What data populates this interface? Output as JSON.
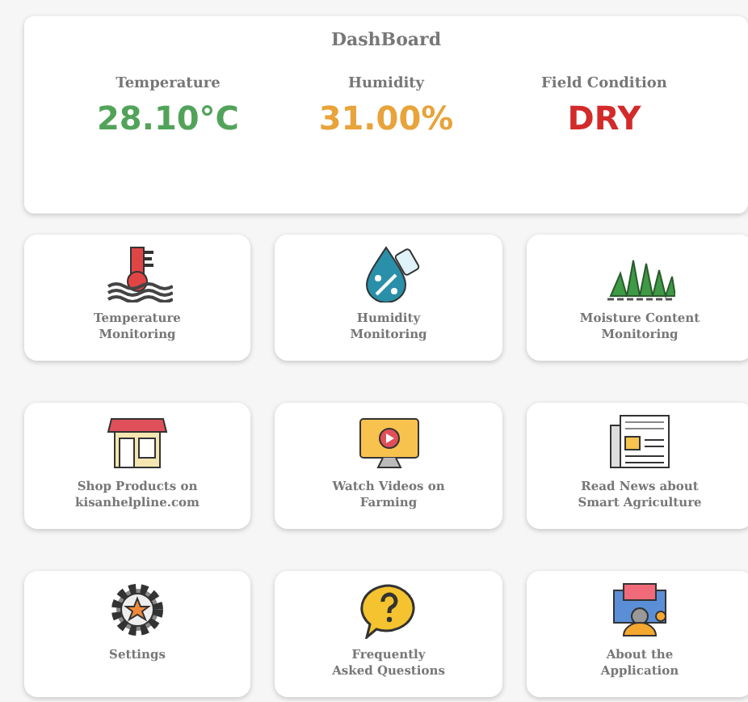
{
  "dashboard": {
    "title": "DashBoard",
    "stats": [
      {
        "label": "Temperature",
        "value": "28.10°C",
        "color": "#52a35a"
      },
      {
        "label": "Humidity",
        "value": "31.00%",
        "color": "#e8a33a"
      },
      {
        "label": "Field Condition",
        "value": "DRY",
        "color": "#d32a2a"
      }
    ]
  },
  "tiles": [
    {
      "kind": "thermometer",
      "label_lines": [
        "Temperature",
        "Monitoring"
      ]
    },
    {
      "kind": "droplet",
      "label_lines": [
        "Humidity",
        "Monitoring"
      ]
    },
    {
      "kind": "grass",
      "label_lines": [
        "Moisture Content",
        "Monitoring"
      ]
    },
    {
      "kind": "shop",
      "label_lines": [
        "Shop Products on",
        "kisanhelpline.com"
      ]
    },
    {
      "kind": "video",
      "label_lines": [
        "Watch Videos on",
        "Farming"
      ]
    },
    {
      "kind": "news",
      "label_lines": [
        "Read News about",
        "Smart Agriculture"
      ]
    },
    {
      "kind": "gear",
      "label_lines": [
        "Settings"
      ]
    },
    {
      "kind": "question",
      "label_lines": [
        "Frequently",
        "Asked Questions"
      ]
    },
    {
      "kind": "about",
      "label_lines": [
        "About the",
        "Application"
      ]
    }
  ]
}
